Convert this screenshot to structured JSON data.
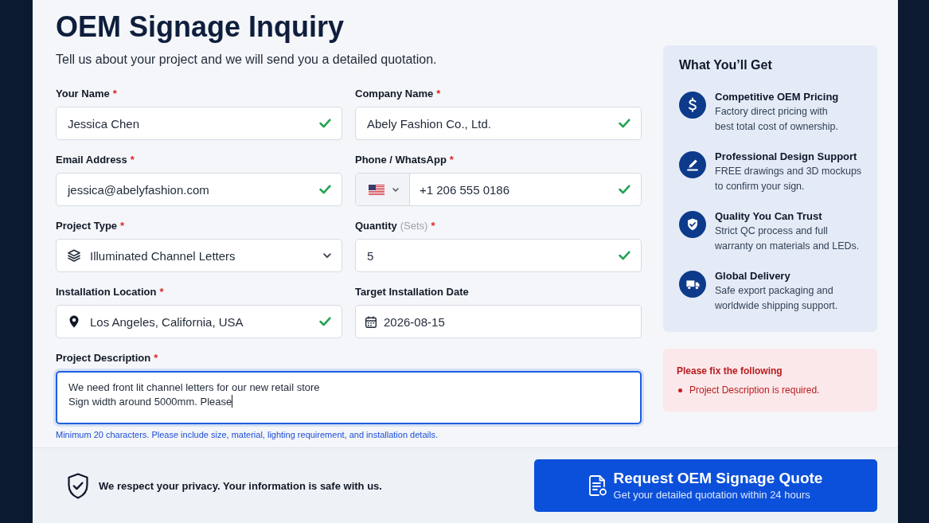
{
  "title": "OEM Signage Inquiry",
  "subtitle": "Tell us about your project and we will send you a detailed quotation.",
  "fields": [
    {
      "kind": "text",
      "label": "Your Name",
      "required_mark": "*",
      "value": "Jessica Chen",
      "valid": true,
      "focused": false
    },
    {
      "kind": "text",
      "label": "Company Name",
      "required_mark": "*",
      "value": "Abely Fashion Co., Ltd.",
      "valid": true,
      "focused": false
    },
    {
      "kind": "text",
      "label": "Email Address",
      "required_mark": "*",
      "value": "jessica@abelyfashion.com",
      "valid": true,
      "focused": false
    },
    {
      "kind": "phone",
      "label": "Phone / WhatsApp",
      "required_mark": "*",
      "value": "+1 206 555 0186",
      "valid": true,
      "focused": false
    },
    {
      "kind": "select",
      "label": "Project Type",
      "required_mark": "*",
      "value": "Illuminated Channel Letters",
      "valid": false,
      "focused": false
    },
    {
      "kind": "text",
      "label": "Quantity",
      "unit": "(Sets)",
      "required_mark": "*",
      "value": "5",
      "valid": true,
      "focused": false
    },
    {
      "kind": "location",
      "label": "Installation Location",
      "required_mark": "*",
      "value": "Los Angeles, California, USA",
      "valid": true,
      "focused": false
    },
    {
      "kind": "date",
      "label": "Target Installation Date",
      "value": "2026-08-15",
      "valid": false,
      "focused": false
    },
    {
      "kind": "textarea",
      "label": "Project Description",
      "required_mark": "*",
      "value": "We need front lit channel letters for our new retail store\nSign width around 5000mm. Please",
      "valid": false,
      "focused": true,
      "hint": "Minimum 20 characters. Please include size, material, lighting requirement, and installation details."
    }
  ],
  "benefits": {
    "title": "What You’ll Get",
    "items": [
      {
        "title": "Competitive OEM Pricing",
        "description": "Factory direct pricing with\nbest total cost of ownership."
      },
      {
        "title": "Professional Design Support",
        "description": "FREE drawings and 3D mockups\nto confirm your sign."
      },
      {
        "title": "Quality You Can Trust",
        "description": "Strict QC process and full\nwarranty on materials and LEDs."
      },
      {
        "title": "Global Delivery",
        "description": "Safe export packaging and\nworldwide shipping support."
      }
    ]
  },
  "errors": {
    "title": "Please fix the following",
    "items": [
      "Project Description is required."
    ]
  },
  "footer": {
    "privacy_note": "We respect your privacy. Your information is safe with us.",
    "submit_button": {
      "title": "Request OEM Signage Quote",
      "subtitle": "Get your detailed quotation within 24 hours"
    }
  }
}
